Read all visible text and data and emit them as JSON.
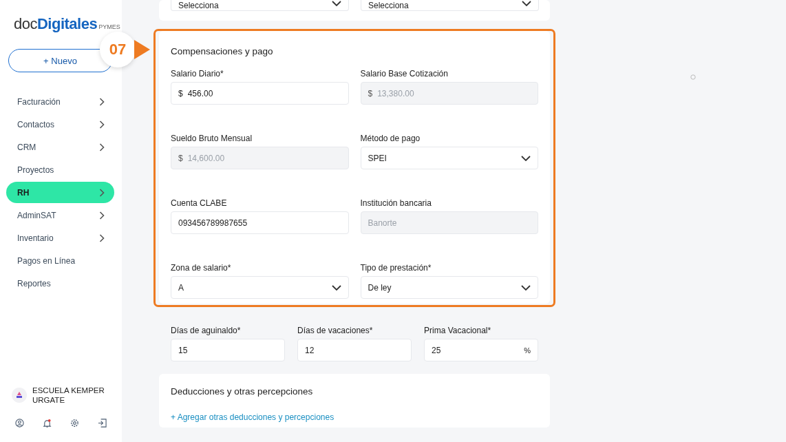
{
  "sidebar": {
    "logo": {
      "part_1": "doc",
      "part_2": "Digitales",
      "part_3": "PYMES"
    },
    "new_button": "+ Nuevo",
    "items": [
      {
        "label": "Facturación",
        "kind": "group",
        "selected": false
      },
      {
        "label": "Contactos",
        "kind": "group",
        "selected": false
      },
      {
        "label": "CRM",
        "kind": "group",
        "selected": false
      },
      {
        "label": "Proyectos",
        "kind": "link",
        "selected": false
      },
      {
        "label": "RH",
        "kind": "group",
        "selected": true
      },
      {
        "label": "AdminSAT",
        "kind": "group",
        "selected": false
      },
      {
        "label": "Inventario",
        "kind": "group",
        "selected": false
      },
      {
        "label": "Pagos en Línea",
        "kind": "link",
        "selected": false
      },
      {
        "label": "Reportes",
        "kind": "link",
        "selected": false
      }
    ],
    "organization": "ESCUELA KEMPER URGATE",
    "notification_unread": true
  },
  "step_badge": "07",
  "top_selects": [
    {
      "value": "Selecciona"
    },
    {
      "value": "Selecciona"
    }
  ],
  "compensation": {
    "title": "Compensaciones y pago",
    "fields": [
      {
        "label": "Salario Diario*",
        "kind": "text",
        "prefix": "$",
        "value": "456.00",
        "disabled": false
      },
      {
        "label": "Salario Base Cotización",
        "kind": "text",
        "prefix": "$",
        "value": "13,380.00",
        "disabled": true
      },
      {
        "label": "Sueldo Bruto Mensual",
        "kind": "text",
        "prefix": "$",
        "value": "14,600.00",
        "disabled": true
      },
      {
        "label": "Método de pago",
        "kind": "select",
        "value": "SPEI",
        "disabled": false
      },
      {
        "label": "Cuenta CLABE",
        "kind": "text",
        "value": "093456789987655",
        "disabled": false
      },
      {
        "label": "Institución bancaria",
        "kind": "text",
        "value": "Banorte",
        "disabled": true
      },
      {
        "label": "Zona de salario*",
        "kind": "select",
        "value": "A",
        "disabled": false
      },
      {
        "label": "Tipo de prestación*",
        "kind": "select",
        "value": "De ley",
        "disabled": false
      }
    ]
  },
  "benefits": [
    {
      "label": "Días de aguinaldo*",
      "value": "15",
      "disabled": false
    },
    {
      "label": "Días de vacaciones*",
      "value": "12",
      "disabled": false
    },
    {
      "label": "Prima Vacacional*",
      "value": "25",
      "suffix": "%",
      "disabled": false
    }
  ],
  "deductions": {
    "title": "Deducciones y otras percepciones",
    "link": "+ Agregar otras deducciones y percepciones"
  }
}
